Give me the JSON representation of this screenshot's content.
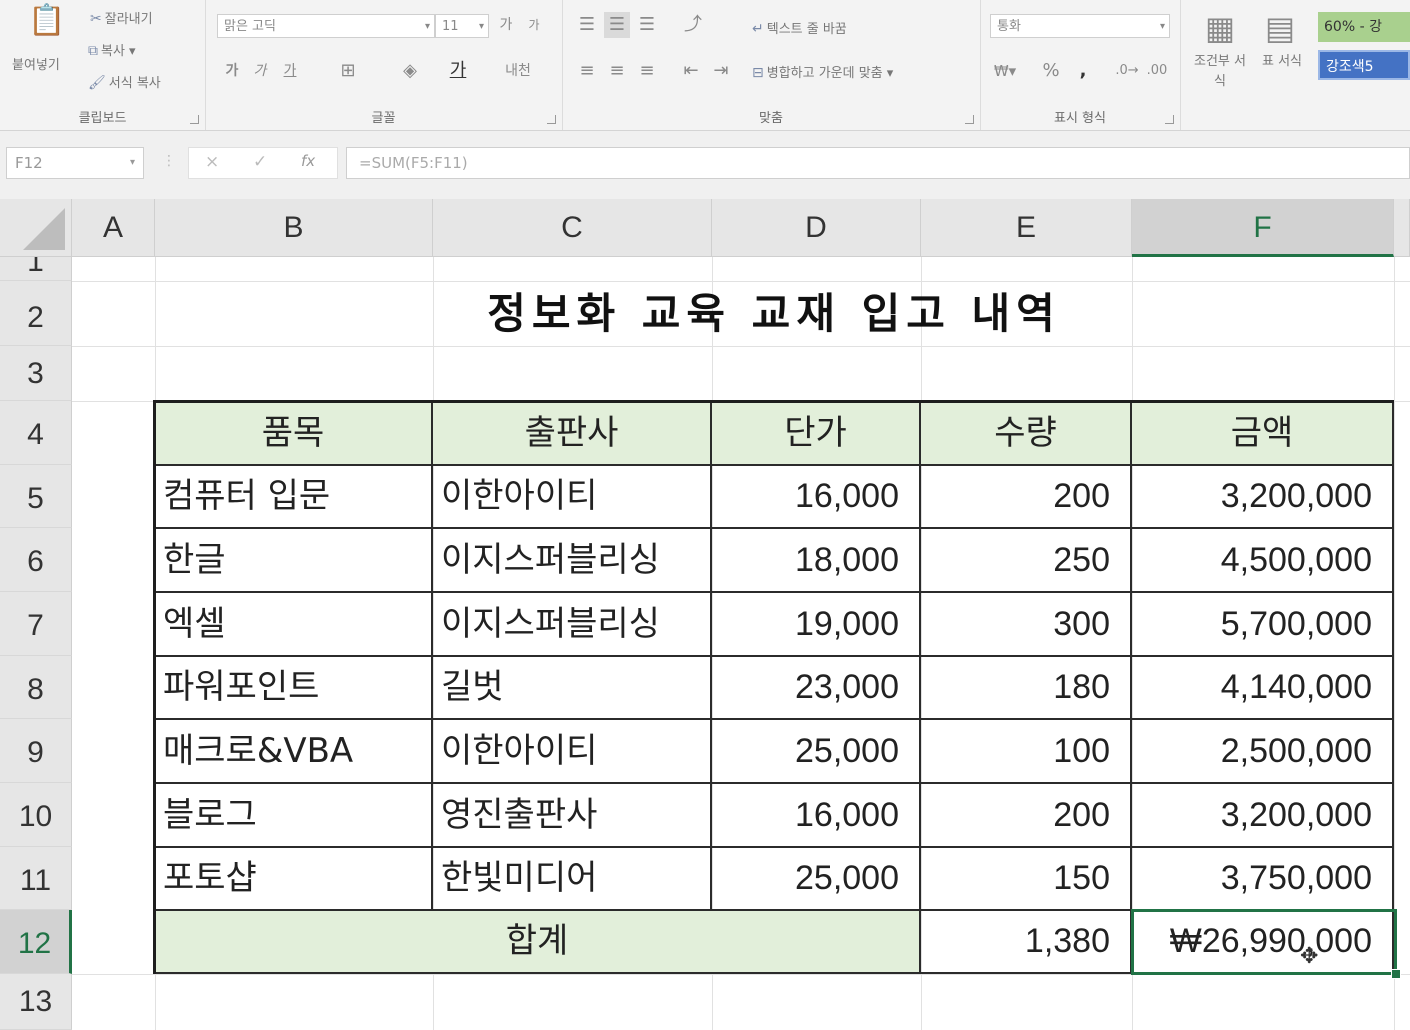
{
  "ribbon": {
    "clipboard": {
      "paste": "붙여넣기",
      "cut": "잘라내기",
      "copy": "복사",
      "format_painter": "서식 복사",
      "label": "클립보드"
    },
    "font": {
      "font_name": "맑은 고딕",
      "font_size": "11",
      "grow": "가",
      "shrink": "가",
      "bold": "가",
      "italic": "가",
      "underline": "가",
      "label": "글꼴"
    },
    "alignment": {
      "wrap_text": "텍스트 줄 바꿈",
      "merge_center": "병합하고 가운데 맞춤",
      "label": "맞춤"
    },
    "number": {
      "format": "통화",
      "percent": "%",
      "comma": ",",
      "label": "표시 형식"
    },
    "styles": {
      "conditional": "조건부 서식",
      "table": "표 서식",
      "style1": "60% - 강",
      "style2": "강조색5"
    }
  },
  "formula_bar": {
    "name_box": "F12",
    "cancel": "×",
    "enter": "✓",
    "fx": "fx",
    "formula": "=SUM(F5:F11)"
  },
  "columns": [
    "A",
    "B",
    "C",
    "D",
    "E",
    "F"
  ],
  "rows": [
    "1",
    "2",
    "3",
    "4",
    "5",
    "6",
    "7",
    "8",
    "9",
    "10",
    "11",
    "12",
    "13"
  ],
  "sheet": {
    "title": "정보화 교육 교재 입고 내역",
    "headers": [
      "품목",
      "출판사",
      "단가",
      "수량",
      "금액"
    ],
    "rows": [
      {
        "item": "컴퓨터 입문",
        "publisher": "이한아이티",
        "price": "16,000",
        "qty": "200",
        "amount": "3,200,000"
      },
      {
        "item": "한글",
        "publisher": "이지스퍼블리싱",
        "price": "18,000",
        "qty": "250",
        "amount": "4,500,000"
      },
      {
        "item": "엑셀",
        "publisher": "이지스퍼블리싱",
        "price": "19,000",
        "qty": "300",
        "amount": "5,700,000"
      },
      {
        "item": "파워포인트",
        "publisher": "길벗",
        "price": "23,000",
        "qty": "180",
        "amount": "4,140,000"
      },
      {
        "item": "매크로&VBA",
        "publisher": "이한아이티",
        "price": "25,000",
        "qty": "100",
        "amount": "2,500,000"
      },
      {
        "item": "블로그",
        "publisher": "영진출판사",
        "price": "16,000",
        "qty": "200",
        "amount": "3,200,000"
      },
      {
        "item": "포토샵",
        "publisher": "한빛미디어",
        "price": "25,000",
        "qty": "150",
        "amount": "3,750,000"
      }
    ],
    "total": {
      "label": "합계",
      "qty": "1,380",
      "amount": "₩26,990,000"
    }
  },
  "colors": {
    "header_fill": "#e2efda",
    "selection": "#217346"
  }
}
